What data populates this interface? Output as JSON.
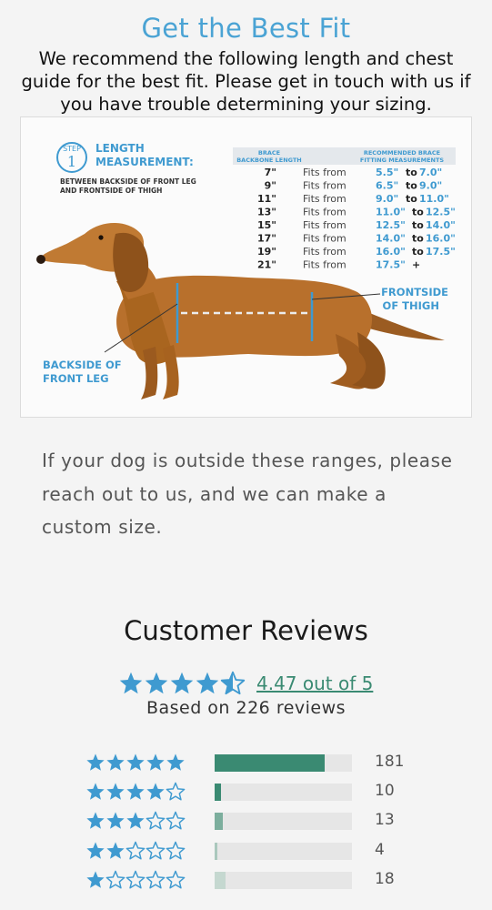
{
  "fit_section": {
    "title": "Get the Best Fit",
    "intro": "We recommend the following length and chest guide for the best fit. Please get in touch with us if you have trouble determining your sizing."
  },
  "guide": {
    "step_word": "STEP",
    "step_number": "1",
    "heading_line1": "LENGTH",
    "heading_line2": "MEASUREMENT:",
    "subheading_line1": "BETWEEN BACKSIDE OF FRONT LEG",
    "subheading_line2": "AND FRONTSIDE OF THIGH",
    "col1_header_line1": "BRACE",
    "col1_header_line2": "BACKBONE LENGTH",
    "col2_header_line1": "RECOMMENDED BRACE",
    "col2_header_line2": "FITTING MEASUREMENTS",
    "rows": [
      {
        "length": "7\"",
        "fits": "Fits from",
        "min": "5.5\"",
        "to": "to",
        "max": "7.0\""
      },
      {
        "length": "9\"",
        "fits": "Fits from",
        "min": "6.5\"",
        "to": "to",
        "max": "9.0\""
      },
      {
        "length": "11\"",
        "fits": "Fits from",
        "min": "9.0\"",
        "to": "to",
        "max": "11.0\""
      },
      {
        "length": "13\"",
        "fits": "Fits from",
        "min": "11.0\"",
        "to": "to",
        "max": "12.5\""
      },
      {
        "length": "15\"",
        "fits": "Fits from",
        "min": "12.5\"",
        "to": "to",
        "max": "14.0\""
      },
      {
        "length": "17\"",
        "fits": "Fits from",
        "min": "14.0\"",
        "to": "to",
        "max": "16.0\""
      },
      {
        "length": "19\"",
        "fits": "Fits from",
        "min": "16.0\"",
        "to": "to",
        "max": "17.5\""
      },
      {
        "length": "21\"",
        "fits": "Fits from",
        "min": "17.5\"",
        "to": "+",
        "max": ""
      }
    ],
    "label_back_line1": "BACKSIDE OF",
    "label_back_line2": "FRONT LEG",
    "label_front_line1": "FRONTSIDE",
    "label_front_line2": "OF THIGH",
    "accent_color": "#3f9ad0",
    "dog_color": "#b8702c"
  },
  "outside_text": "If your dog is outside these ranges, please reach out to us, and we can make a custom size.",
  "reviews": {
    "title": "Customer Reviews",
    "average_rating": 4.47,
    "average_text": "4.47 out of 5",
    "based_on": "Based on 226 reviews",
    "star_color": "#3f9ad0",
    "histogram": [
      {
        "stars": 5,
        "count": "181",
        "fraction": 0.8,
        "color": "#3a8a72"
      },
      {
        "stars": 4,
        "count": "10",
        "fraction": 0.044,
        "color": "#3a8a72"
      },
      {
        "stars": 3,
        "count": "13",
        "fraction": 0.058,
        "color": "#7cae9d"
      },
      {
        "stars": 2,
        "count": "4",
        "fraction": 0.018,
        "color": "#aac8bd"
      },
      {
        "stars": 1,
        "count": "18",
        "fraction": 0.08,
        "color": "#c5d8d0"
      }
    ]
  }
}
